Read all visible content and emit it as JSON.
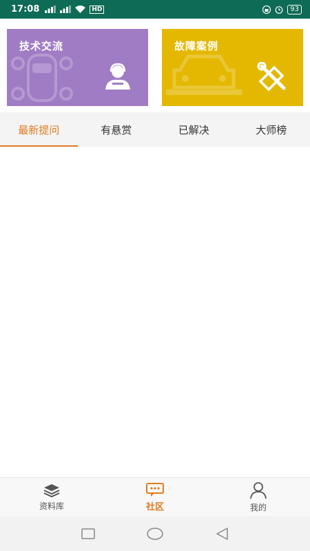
{
  "status_bar": {
    "time": "17:08",
    "signal1": "▂▄▆",
    "signal2": "▂▄▆",
    "hd": "HD",
    "battery": "93"
  },
  "cards": {
    "tech": {
      "title": "技术交流",
      "color": "#a07cc4"
    },
    "fault": {
      "title": "故障案例",
      "color": "#e4b800"
    }
  },
  "tabs": [
    {
      "label": "最新提问",
      "active": true
    },
    {
      "label": "有悬赏",
      "active": false
    },
    {
      "label": "已解决",
      "active": false
    },
    {
      "label": "大师榜",
      "active": false
    }
  ],
  "bottom_nav": {
    "library": "资料库",
    "community": "社区",
    "mine": "我的"
  },
  "colors": {
    "accent": "#e07a20",
    "status_bar": "#0e6b55"
  }
}
